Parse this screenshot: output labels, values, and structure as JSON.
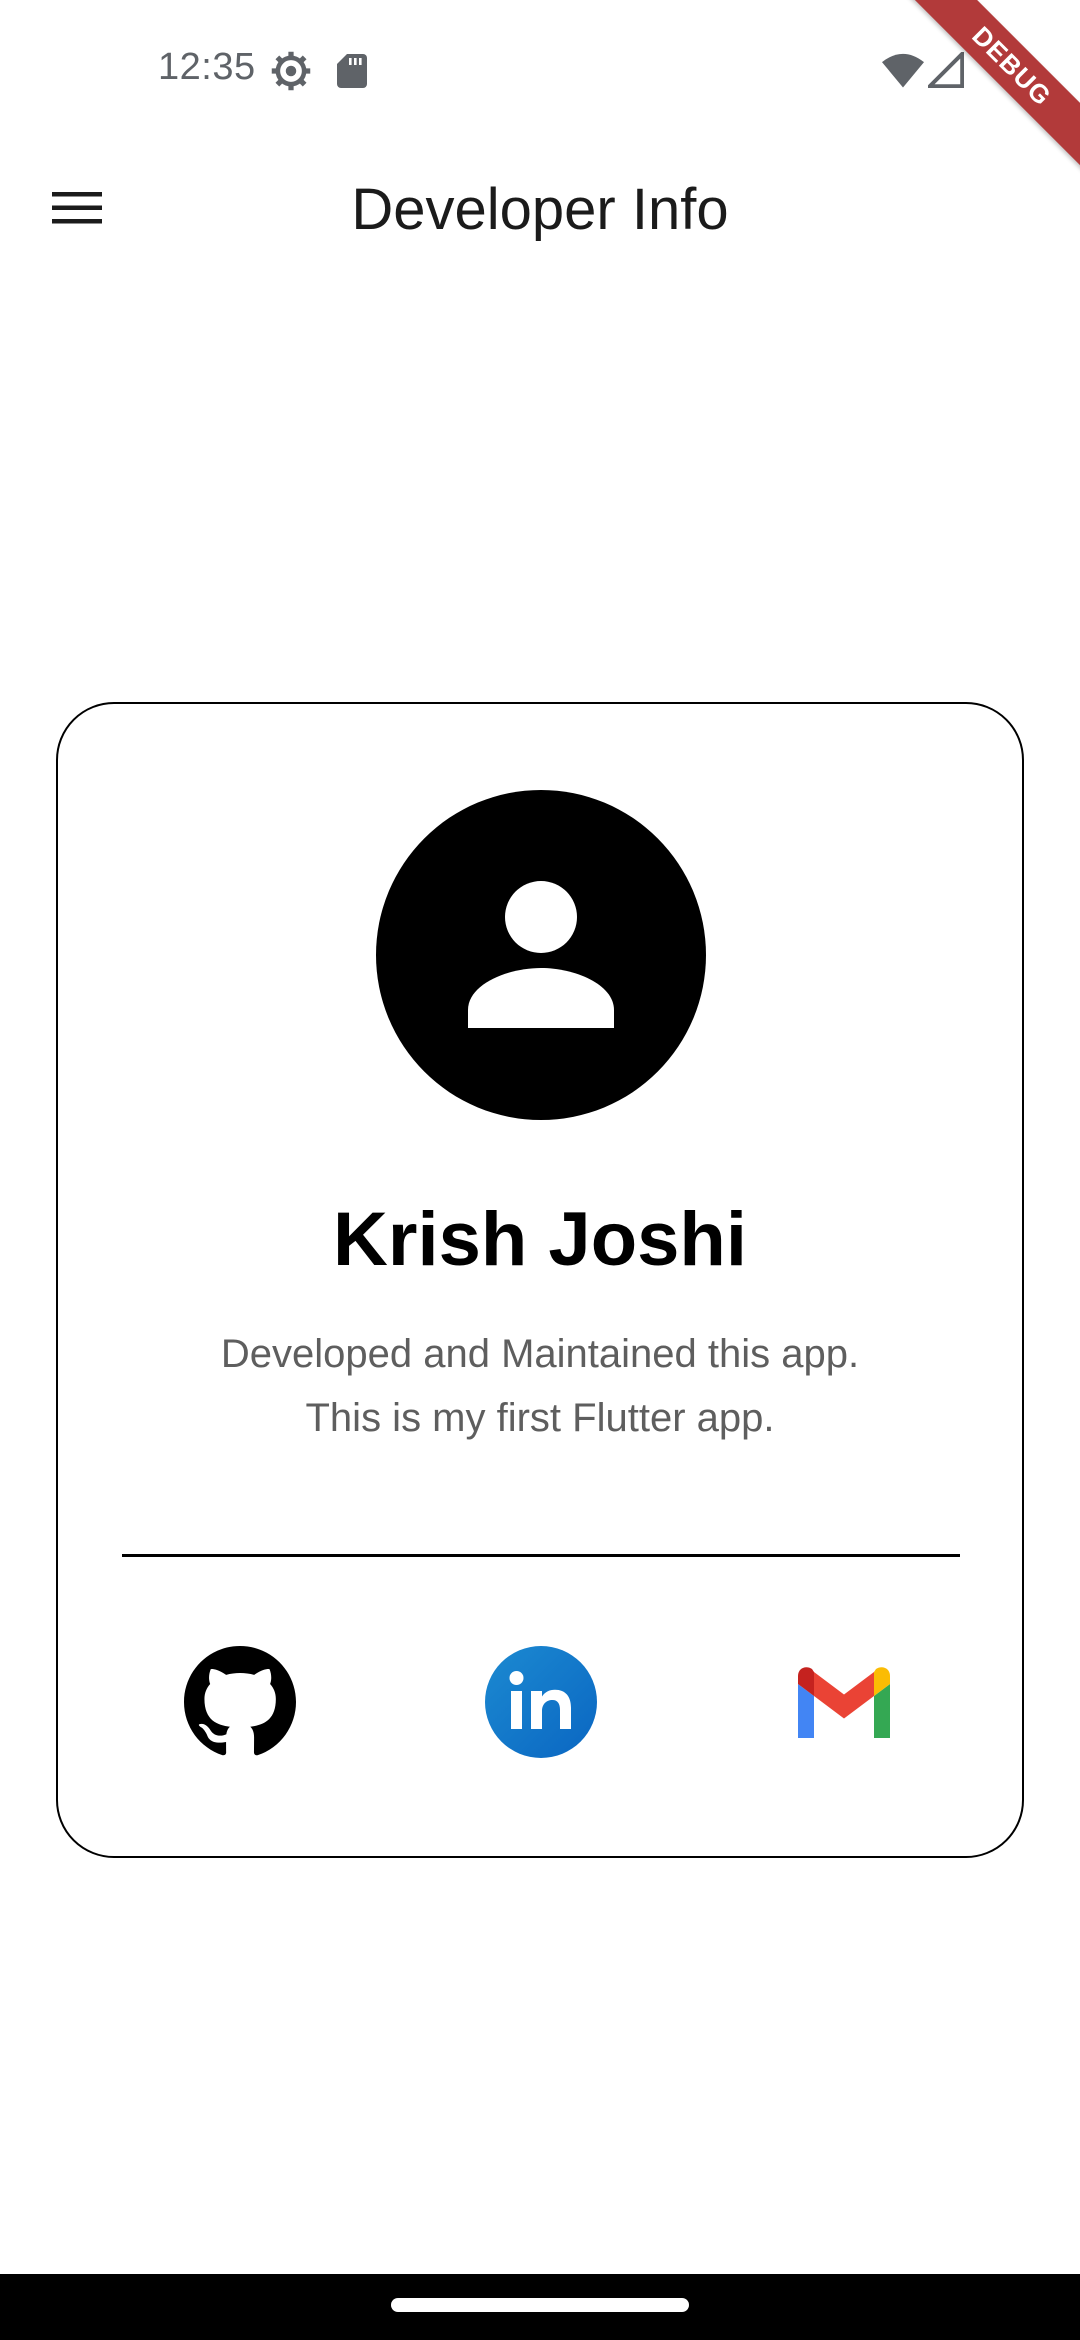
{
  "status_bar": {
    "time": "12:35",
    "icons": [
      "settings-icon",
      "sd-card-icon",
      "wifi-icon",
      "signal-icon"
    ]
  },
  "debug_banner": {
    "label": "DEBUG",
    "color": "#b23a3a"
  },
  "app_bar": {
    "title": "Developer Info",
    "menu_icon": "hamburger-menu-icon"
  },
  "profile_card": {
    "avatar_icon": "person-icon",
    "name": "Krish Joshi",
    "description_line1": "Developed and Maintained this app.",
    "description_line2": "This is my first Flutter app."
  },
  "social_links": [
    {
      "id": "github",
      "icon": "github-icon",
      "color": "#000000"
    },
    {
      "id": "linkedin",
      "icon": "linkedin-icon",
      "color": "#0a66c2"
    },
    {
      "id": "gmail",
      "icon": "gmail-icon",
      "colors": [
        "#4285f4",
        "#ea4335",
        "#fbbc04",
        "#34a853"
      ]
    }
  ],
  "colors": {
    "background": "#ffffff",
    "text_secondary": "#5e5e5e",
    "nav_bar": "#000000"
  }
}
